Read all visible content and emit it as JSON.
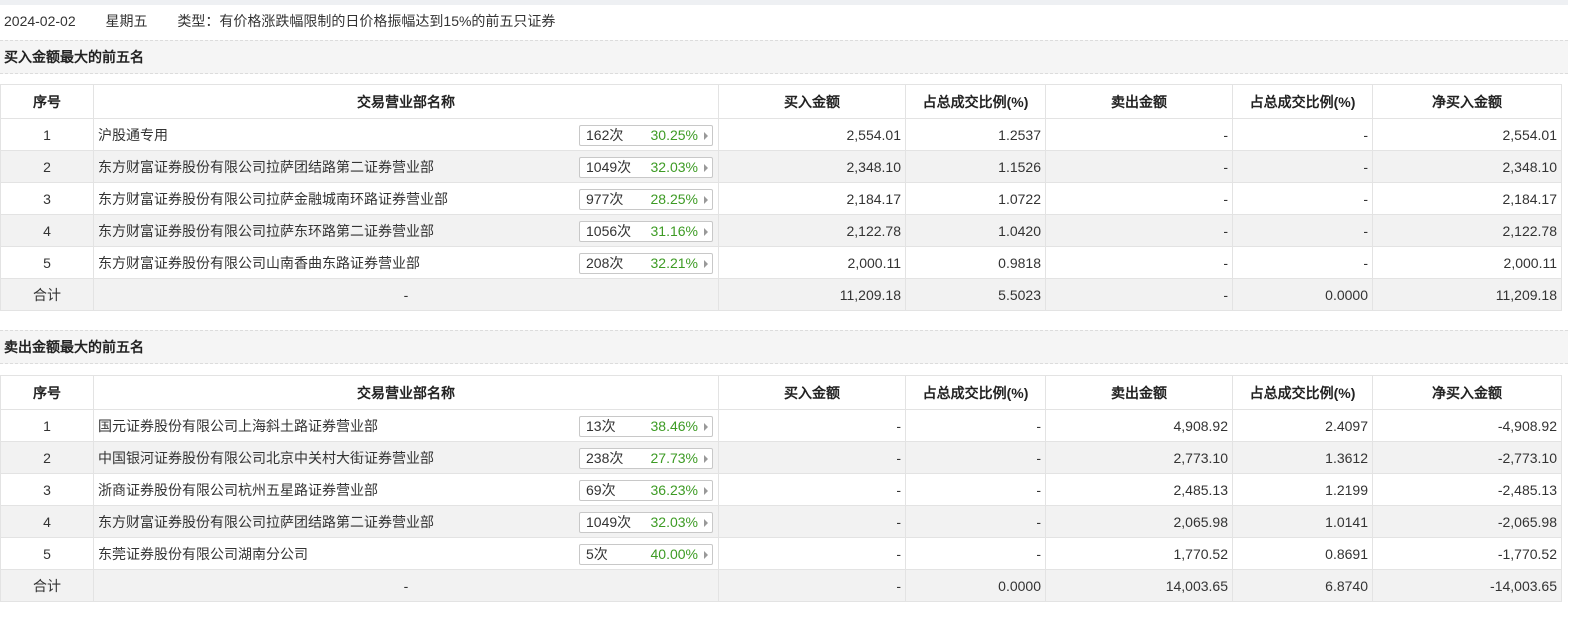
{
  "info": {
    "date": "2024-02-02",
    "weekday": "星期五",
    "type_text": "类型：有价格涨跌幅限制的日价格振幅达到15%的前五只证券"
  },
  "columns": {
    "index": "序号",
    "name": "交易营业部名称",
    "buy": "买入金额",
    "buy_pct": "占总成交比例(%)",
    "sell": "卖出金额",
    "sell_pct": "占总成交比例(%)",
    "net": "净买入金额"
  },
  "buy_section": {
    "title": "买入金额最大的前五名",
    "rows": [
      {
        "idx": "1",
        "name": "沪股通专用",
        "count": "162次",
        "rate": "30.25%",
        "buy": "2,554.01",
        "buy_pct": "1.2537",
        "sell": "-",
        "sell_pct": "-",
        "net": "2,554.01"
      },
      {
        "idx": "2",
        "name": "东方财富证券股份有限公司拉萨团结路第二证券营业部",
        "count": "1049次",
        "rate": "32.03%",
        "buy": "2,348.10",
        "buy_pct": "1.1526",
        "sell": "-",
        "sell_pct": "-",
        "net": "2,348.10"
      },
      {
        "idx": "3",
        "name": "东方财富证券股份有限公司拉萨金融城南环路证券营业部",
        "count": "977次",
        "rate": "28.25%",
        "buy": "2,184.17",
        "buy_pct": "1.0722",
        "sell": "-",
        "sell_pct": "-",
        "net": "2,184.17"
      },
      {
        "idx": "4",
        "name": "东方财富证券股份有限公司拉萨东环路第二证券营业部",
        "count": "1056次",
        "rate": "31.16%",
        "buy": "2,122.78",
        "buy_pct": "1.0420",
        "sell": "-",
        "sell_pct": "-",
        "net": "2,122.78"
      },
      {
        "idx": "5",
        "name": "东方财富证券股份有限公司山南香曲东路证券营业部",
        "count": "208次",
        "rate": "32.21%",
        "buy": "2,000.11",
        "buy_pct": "0.9818",
        "sell": "-",
        "sell_pct": "-",
        "net": "2,000.11"
      }
    ],
    "total": {
      "label": "合计",
      "name": "-",
      "buy": "11,209.18",
      "buy_pct": "5.5023",
      "sell": "-",
      "sell_pct": "0.0000",
      "net": "11,209.18"
    }
  },
  "sell_section": {
    "title": "卖出金额最大的前五名",
    "rows": [
      {
        "idx": "1",
        "name": "国元证券股份有限公司上海斜土路证券营业部",
        "count": "13次",
        "rate": "38.46%",
        "buy": "-",
        "buy_pct": "-",
        "sell": "4,908.92",
        "sell_pct": "2.4097",
        "net": "-4,908.92"
      },
      {
        "idx": "2",
        "name": "中国银河证券股份有限公司北京中关村大街证券营业部",
        "count": "238次",
        "rate": "27.73%",
        "buy": "-",
        "buy_pct": "-",
        "sell": "2,773.10",
        "sell_pct": "1.3612",
        "net": "-2,773.10"
      },
      {
        "idx": "3",
        "name": "浙商证券股份有限公司杭州五星路证券营业部",
        "count": "69次",
        "rate": "36.23%",
        "buy": "-",
        "buy_pct": "-",
        "sell": "2,485.13",
        "sell_pct": "1.2199",
        "net": "-2,485.13"
      },
      {
        "idx": "4",
        "name": "东方财富证券股份有限公司拉萨团结路第二证券营业部",
        "count": "1049次",
        "rate": "32.03%",
        "buy": "-",
        "buy_pct": "-",
        "sell": "2,065.98",
        "sell_pct": "1.0141",
        "net": "-2,065.98"
      },
      {
        "idx": "5",
        "name": "东莞证券股份有限公司湖南分公司",
        "count": "5次",
        "rate": "40.00%",
        "buy": "-",
        "buy_pct": "-",
        "sell": "1,770.52",
        "sell_pct": "0.8691",
        "net": "-1,770.52"
      }
    ],
    "total": {
      "label": "合计",
      "name": "-",
      "buy": "-",
      "buy_pct": "0.0000",
      "sell": "14,003.65",
      "sell_pct": "6.8740",
      "net": "-14,003.65"
    }
  },
  "colors": {
    "up": "#e4140f",
    "down": "#3d9b24"
  }
}
